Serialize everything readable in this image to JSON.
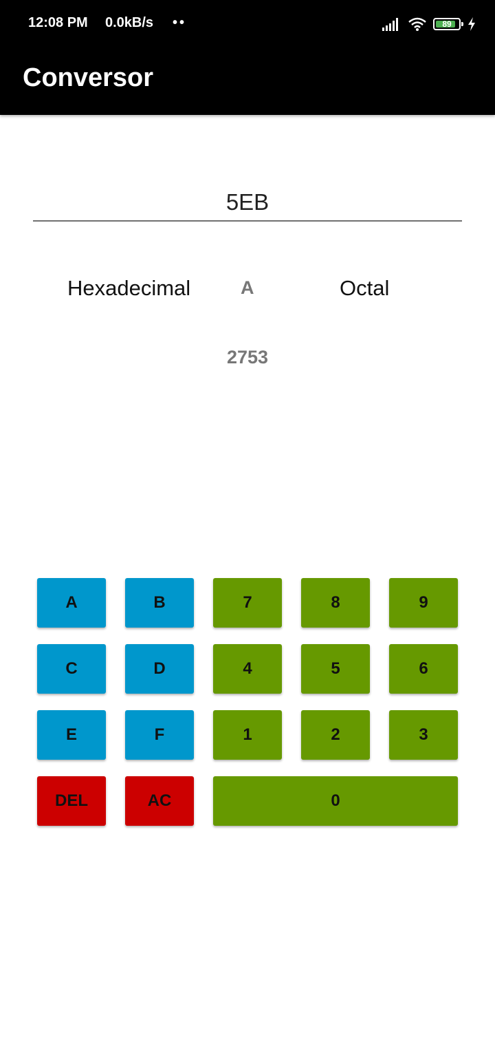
{
  "status_bar": {
    "time": "12:08 PM",
    "speed": "0.0kB/s",
    "dots": "••",
    "battery": "89"
  },
  "app_bar": {
    "title": "Conversor"
  },
  "converter": {
    "input_value": "5EB",
    "from_base": "Hexadecimal",
    "separator": "A",
    "to_base": "Octal",
    "result": "2753"
  },
  "keypad": {
    "a": "A",
    "b": "B",
    "c": "C",
    "d": "D",
    "e": "E",
    "f": "F",
    "k7": "7",
    "k8": "8",
    "k9": "9",
    "k4": "4",
    "k5": "5",
    "k6": "6",
    "k1": "1",
    "k2": "2",
    "k3": "3",
    "k0": "0",
    "del": "DEL",
    "ac": "AC"
  },
  "colors": {
    "hex_key": "#0097cc",
    "digit_key": "#669900",
    "action_key": "#cc0000",
    "battery_fill": "#4caf50"
  },
  "battery_level": 0.89
}
